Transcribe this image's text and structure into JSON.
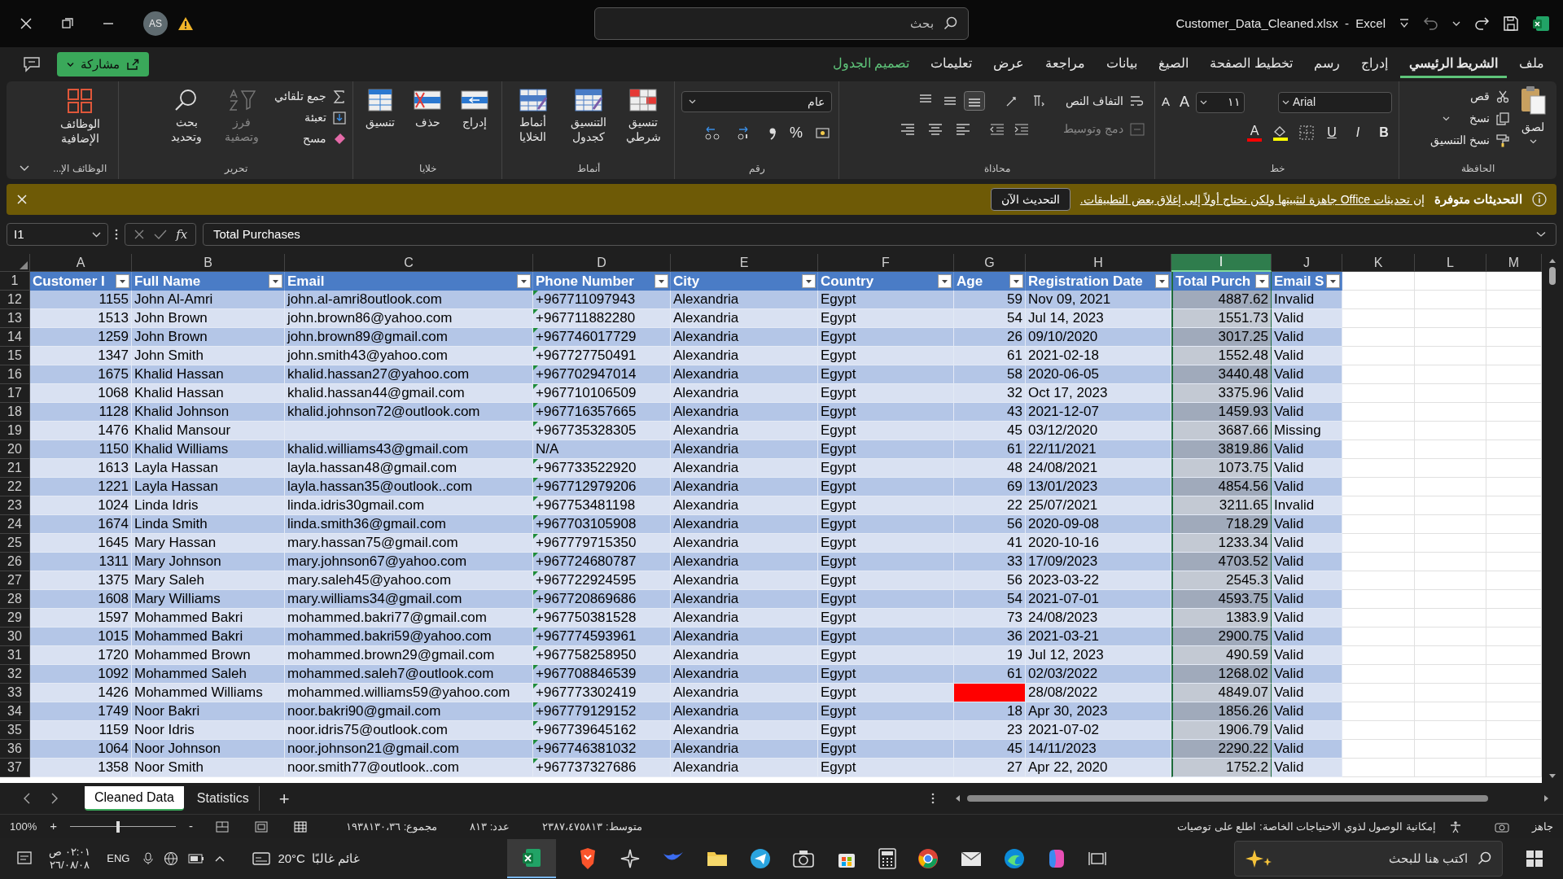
{
  "title_bar": {
    "avatar": "AS",
    "search_placeholder": "بحث",
    "file_title": "Customer_Data_Cleaned.xlsx  -  Excel"
  },
  "ribbon_tabs": [
    {
      "label": "ملف",
      "selected": false,
      "kind": "normal"
    },
    {
      "label": "الشريط الرئيسي",
      "selected": true,
      "kind": "normal"
    },
    {
      "label": "إدراج",
      "selected": false,
      "kind": "normal"
    },
    {
      "label": "رسم",
      "selected": false,
      "kind": "normal"
    },
    {
      "label": "تخطيط الصفحة",
      "selected": false,
      "kind": "normal"
    },
    {
      "label": "الصيغ",
      "selected": false,
      "kind": "normal"
    },
    {
      "label": "بيانات",
      "selected": false,
      "kind": "normal"
    },
    {
      "label": "مراجعة",
      "selected": false,
      "kind": "normal"
    },
    {
      "label": "عرض",
      "selected": false,
      "kind": "normal"
    },
    {
      "label": "تعليمات",
      "selected": false,
      "kind": "normal"
    },
    {
      "label": "تصميم الجدول",
      "selected": false,
      "kind": "contextual"
    }
  ],
  "share_button": "مشاركة",
  "ribbon": {
    "clipboard": {
      "label": "الحافظة",
      "paste": "لصق",
      "cut": "قص",
      "copy": "نسخ",
      "format_painter": "نسخ التنسيق"
    },
    "font": {
      "label": "خط",
      "name": "Arial",
      "size": "١١",
      "grow": "A",
      "shrink": "A",
      "bold": "B",
      "italic": "I",
      "underline": "U",
      "color_letter": "A"
    },
    "alignment": {
      "label": "محاذاة",
      "wrap_text": "التفاف النص",
      "merge": {
        "label": "دمج وتوسيط",
        "disabled": true
      }
    },
    "number": {
      "label": "رقم",
      "format": "عام",
      "percent": "%"
    },
    "styles": {
      "label": "أنماط",
      "conditional": "تنسيق شرطي",
      "as_table": "التنسيق كجدول",
      "cell_styles": "أنماط الخلايا"
    },
    "cells": {
      "label": "خلايا",
      "insert": "إدراج",
      "delete": "حذف",
      "format": "تنسيق"
    },
    "editing": {
      "label": "تحرير",
      "autosum": "جمع تلقائي",
      "fill": "تعبئة",
      "clear": "مسح",
      "sort": {
        "label": "فرز وتصفية",
        "disabled": true
      },
      "find": "بحث وتحديد"
    },
    "addins": {
      "label": "الوظائف الإ...",
      "button": "الوظائف الإضافية"
    }
  },
  "notification": {
    "title": "التحديثات متوفرة",
    "message": "إن تحديثات Office جاهزة لتثبيتها ولكن نحتاج أولاً إلى إغلاق بعض التطبيقات.",
    "button": "التحديث الآن"
  },
  "formula_bar": {
    "name_box": "I1",
    "fx": "fx",
    "formula": "Total Purchases"
  },
  "sheet": {
    "header_row_number": "1",
    "columns": [
      {
        "letter": "A",
        "header": "Customer I",
        "selected": false
      },
      {
        "letter": "B",
        "header": "Full Name",
        "selected": false
      },
      {
        "letter": "C",
        "header": "Email",
        "selected": false
      },
      {
        "letter": "D",
        "header": "Phone Number",
        "selected": false
      },
      {
        "letter": "E",
        "header": "City",
        "selected": false
      },
      {
        "letter": "F",
        "header": "Country",
        "selected": false
      },
      {
        "letter": "G",
        "header": "Age",
        "selected": false
      },
      {
        "letter": "H",
        "header": "Registration Date",
        "selected": false
      },
      {
        "letter": "I",
        "header": "Total Purch",
        "selected": true
      },
      {
        "letter": "J",
        "header": "Email S",
        "selected": false
      },
      {
        "letter": "K",
        "selected": false
      },
      {
        "letter": "L",
        "selected": false
      },
      {
        "letter": "M",
        "selected": false
      }
    ],
    "rows": [
      {
        "row": "12",
        "id": "1155",
        "name": "John Al-Amri",
        "email": "john.al-amri8outlook.com",
        "phone": "+967711097943",
        "city": "Alexandria",
        "country": "Egypt",
        "age": "59",
        "date": "Nov 09, 2021",
        "total": "4887.62",
        "status": "Invalid",
        "phone_flag": true,
        "age_alert": false
      },
      {
        "row": "13",
        "id": "1513",
        "name": "John Brown",
        "email": "john.brown86@yahoo.com",
        "phone": "+967711882280",
        "city": "Alexandria",
        "country": "Egypt",
        "age": "54",
        "date": "Jul 14, 2023",
        "total": "1551.73",
        "status": "Valid",
        "phone_flag": true,
        "age_alert": false
      },
      {
        "row": "14",
        "id": "1259",
        "name": "John Brown",
        "email": "john.brown89@gmail.com",
        "phone": "+967746017729",
        "city": "Alexandria",
        "country": "Egypt",
        "age": "26",
        "date": "09/10/2020",
        "total": "3017.25",
        "status": "Valid",
        "phone_flag": true,
        "age_alert": false
      },
      {
        "row": "15",
        "id": "1347",
        "name": "John Smith",
        "email": "john.smith43@yahoo.com",
        "phone": "+967727750491",
        "city": "Alexandria",
        "country": "Egypt",
        "age": "61",
        "date": "2021-02-18",
        "total": "1552.48",
        "status": "Valid",
        "phone_flag": true,
        "age_alert": false
      },
      {
        "row": "16",
        "id": "1675",
        "name": "Khalid Hassan",
        "email": "khalid.hassan27@yahoo.com",
        "phone": "+967702947014",
        "city": "Alexandria",
        "country": "Egypt",
        "age": "58",
        "date": "2020-06-05",
        "total": "3440.48",
        "status": "Valid",
        "phone_flag": true,
        "age_alert": false
      },
      {
        "row": "17",
        "id": "1068",
        "name": "Khalid Hassan",
        "email": "khalid.hassan44@gmail.com",
        "phone": "+967710106509",
        "city": "Alexandria",
        "country": "Egypt",
        "age": "32",
        "date": "Oct 17, 2023",
        "total": "3375.96",
        "status": "Valid",
        "phone_flag": true,
        "age_alert": false
      },
      {
        "row": "18",
        "id": "1128",
        "name": "Khalid Johnson",
        "email": "khalid.johnson72@outlook.com",
        "phone": "+967716357665",
        "city": "Alexandria",
        "country": "Egypt",
        "age": "43",
        "date": "2021-12-07",
        "total": "1459.93",
        "status": "Valid",
        "phone_flag": true,
        "age_alert": false
      },
      {
        "row": "19",
        "id": "1476",
        "name": "Khalid Mansour",
        "phone": "+967735328305",
        "city": "Alexandria",
        "country": "Egypt",
        "age": "45",
        "date": "03/12/2020",
        "total": "3687.66",
        "status": "Missing",
        "phone_flag": true,
        "age_alert": false
      },
      {
        "row": "20",
        "id": "1150",
        "name": "Khalid Williams",
        "email": "khalid.williams43@gmail.com",
        "phone": "N/A",
        "city": "Alexandria",
        "country": "Egypt",
        "age": "61",
        "date": "22/11/2021",
        "total": "3819.86",
        "status": "Valid",
        "phone_flag": false,
        "age_alert": false
      },
      {
        "row": "21",
        "id": "1613",
        "name": "Layla Hassan",
        "email": "layla.hassan48@gmail.com",
        "phone": "+967733522920",
        "city": "Alexandria",
        "country": "Egypt",
        "age": "48",
        "date": "24/08/2021",
        "total": "1073.75",
        "status": "Valid",
        "phone_flag": true,
        "age_alert": false
      },
      {
        "row": "22",
        "id": "1221",
        "name": "Layla Hassan",
        "email": "layla.hassan35@outlook..com",
        "phone": "+967712979206",
        "city": "Alexandria",
        "country": "Egypt",
        "age": "69",
        "date": "13/01/2023",
        "total": "4854.56",
        "status": "Valid",
        "phone_flag": true,
        "age_alert": false
      },
      {
        "row": "23",
        "id": "1024",
        "name": "Linda Idris",
        "email": "linda.idris30gmail.com",
        "phone": "+967753481198",
        "city": "Alexandria",
        "country": "Egypt",
        "age": "22",
        "date": "25/07/2021",
        "total": "3211.65",
        "status": "Invalid",
        "phone_flag": true,
        "age_alert": false
      },
      {
        "row": "24",
        "id": "1674",
        "name": "Linda Smith",
        "email": "linda.smith36@gmail.com",
        "phone": "+967703105908",
        "city": "Alexandria",
        "country": "Egypt",
        "age": "56",
        "date": "2020-09-08",
        "total": "718.29",
        "status": "Valid",
        "phone_flag": true,
        "age_alert": false
      },
      {
        "row": "25",
        "id": "1645",
        "name": "Mary Hassan",
        "email": "mary.hassan75@gmail.com",
        "phone": "+967779715350",
        "city": "Alexandria",
        "country": "Egypt",
        "age": "41",
        "date": "2020-10-16",
        "total": "1233.34",
        "status": "Valid",
        "phone_flag": true,
        "age_alert": false
      },
      {
        "row": "26",
        "id": "1311",
        "name": "Mary Johnson",
        "email": "mary.johnson67@yahoo.com",
        "phone": "+967724680787",
        "city": "Alexandria",
        "country": "Egypt",
        "age": "33",
        "date": "17/09/2023",
        "total": "4703.52",
        "status": "Valid",
        "phone_flag": true,
        "age_alert": false
      },
      {
        "row": "27",
        "id": "1375",
        "name": "Mary Saleh",
        "email": "mary.saleh45@yahoo.com",
        "phone": "+967722924595",
        "city": "Alexandria",
        "country": "Egypt",
        "age": "56",
        "date": "2023-03-22",
        "total": "2545.3",
        "status": "Valid",
        "phone_flag": true,
        "age_alert": false
      },
      {
        "row": "28",
        "id": "1608",
        "name": "Mary Williams",
        "email": "mary.williams34@gmail.com",
        "phone": "+967720869686",
        "city": "Alexandria",
        "country": "Egypt",
        "age": "54",
        "date": "2021-07-01",
        "total": "4593.75",
        "status": "Valid",
        "phone_flag": true,
        "age_alert": false
      },
      {
        "row": "29",
        "id": "1597",
        "name": "Mohammed Bakri",
        "email": "mohammed.bakri77@gmail.com",
        "phone": "+967750381528",
        "city": "Alexandria",
        "country": "Egypt",
        "age": "73",
        "date": "24/08/2023",
        "total": "1383.9",
        "status": "Valid",
        "phone_flag": true,
        "age_alert": false
      },
      {
        "row": "30",
        "id": "1015",
        "name": "Mohammed Bakri",
        "email": "mohammed.bakri59@yahoo.com",
        "phone": "+967774593961",
        "city": "Alexandria",
        "country": "Egypt",
        "age": "36",
        "date": "2021-03-21",
        "total": "2900.75",
        "status": "Valid",
        "phone_flag": true,
        "age_alert": false
      },
      {
        "row": "31",
        "id": "1720",
        "name": "Mohammed Brown",
        "email": "mohammed.brown29@gmail.com",
        "phone": "+967758258950",
        "city": "Alexandria",
        "country": "Egypt",
        "age": "19",
        "date": "Jul 12, 2023",
        "total": "490.59",
        "status": "Valid",
        "phone_flag": true,
        "age_alert": false
      },
      {
        "row": "32",
        "id": "1092",
        "name": "Mohammed Saleh",
        "email": "mohammed.saleh7@outlook.com",
        "phone": "+967708846539",
        "city": "Alexandria",
        "country": "Egypt",
        "age": "61",
        "date": "02/03/2022",
        "total": "1268.02",
        "status": "Valid",
        "phone_flag": true,
        "age_alert": false
      },
      {
        "row": "33",
        "id": "1426",
        "name": "Mohammed Williams",
        "email": "mohammed.williams59@yahoo.com",
        "phone": "+967773302419",
        "city": "Alexandria",
        "country": "Egypt",
        "date": "28/08/2022",
        "total": "4849.07",
        "status": "Valid",
        "phone_flag": true,
        "age_alert": true
      },
      {
        "row": "34",
        "id": "1749",
        "name": "Noor Bakri",
        "email": "noor.bakri90@gmail.com",
        "phone": "+967779129152",
        "city": "Alexandria",
        "country": "Egypt",
        "age": "18",
        "date": "Apr 30, 2023",
        "total": "1856.26",
        "status": "Valid",
        "phone_flag": true,
        "age_alert": false
      },
      {
        "row": "35",
        "id": "1159",
        "name": "Noor Idris",
        "email": "noor.idris75@outlook.com",
        "phone": "+967739645162",
        "city": "Alexandria",
        "country": "Egypt",
        "age": "23",
        "date": "2021-07-02",
        "total": "1906.79",
        "status": "Valid",
        "phone_flag": true,
        "age_alert": false
      },
      {
        "row": "36",
        "id": "1064",
        "name": "Noor Johnson",
        "email": "noor.johnson21@gmail.com",
        "phone": "+967746381032",
        "city": "Alexandria",
        "country": "Egypt",
        "age": "45",
        "date": "14/11/2023",
        "total": "2290.22",
        "status": "Valid",
        "phone_flag": true,
        "age_alert": false
      },
      {
        "row": "37",
        "id": "1358",
        "name": "Noor Smith",
        "email": "noor.smith77@outlook..com",
        "phone": "+967737327686",
        "city": "Alexandria",
        "country": "Egypt",
        "age": "27",
        "date": "Apr 22, 2020",
        "total": "1752.2",
        "status": "Valid",
        "phone_flag": true,
        "age_alert": false
      }
    ]
  },
  "sheet_tabs": [
    {
      "label": "Cleaned Data",
      "selected": true
    },
    {
      "label": "Statistics",
      "selected": false
    }
  ],
  "add_sheet": "+",
  "status_bar": {
    "ready": "جاهز",
    "accessibility": "إمكانية الوصول لذوي الاحتياجات الخاصة: اطلع على توصيات",
    "average": "متوسط: ٢٣٨٧،٤٧٥٨١٣",
    "count": "عدد: ٨١٣",
    "sum": "مجموع: ١٩٣٨١٣٠،٣٦",
    "zoom": "100%",
    "zoom_in": "+",
    "zoom_out": "-",
    "zoom_slider": {
      "level": 0.45
    }
  },
  "taskbar": {
    "search_placeholder": "اكتب هنا للبحث",
    "weather_temp": "20°C",
    "weather_text": "غائم غالبًا",
    "language": "ENG",
    "time": "٠٢:٠١ ص",
    "date": "٢٦/٠٨/٠٨"
  }
}
